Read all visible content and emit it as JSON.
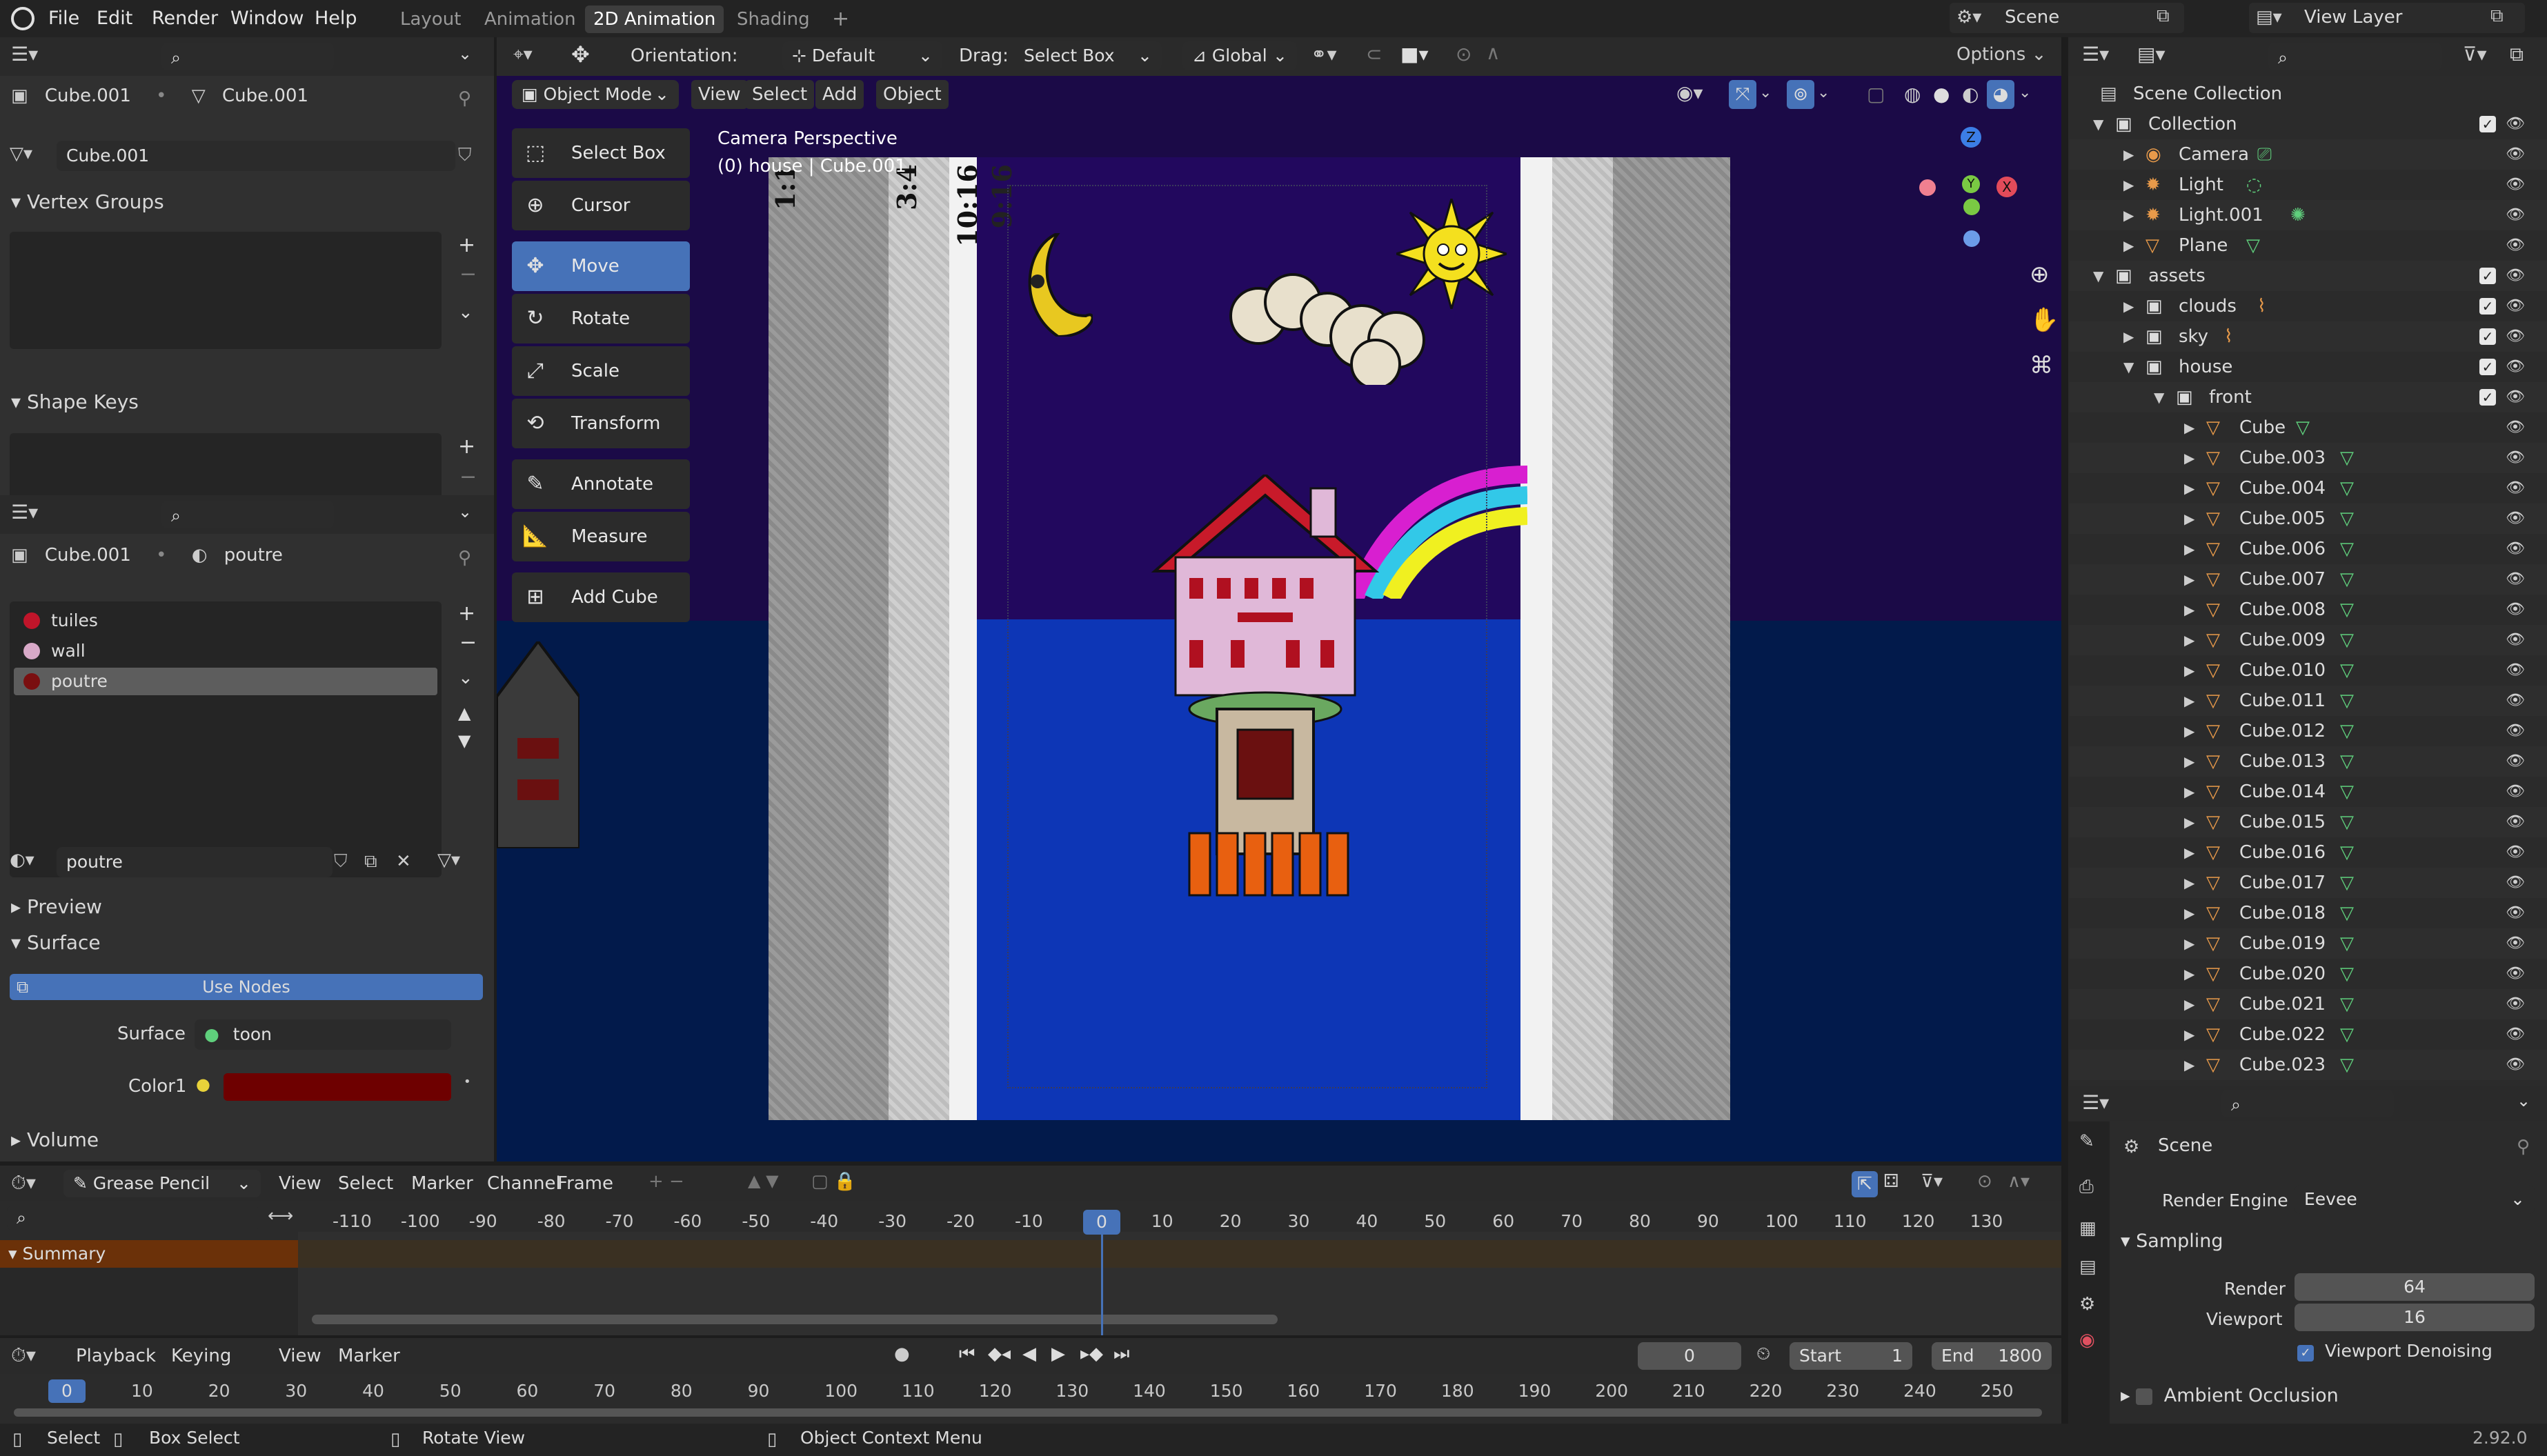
{
  "app": {
    "version": "2.92.0"
  },
  "menubar": {
    "items": [
      "File",
      "Edit",
      "Render",
      "Window",
      "Help"
    ],
    "tabs": [
      "Layout",
      "Animation",
      "2D Animation",
      "Shading"
    ],
    "active_tab": "2D Animation",
    "scene": "Scene",
    "view_layer": "View Layer"
  },
  "left": {
    "object_name": "Cube.001",
    "mesh_name": "Cube.001",
    "mesh_field": "Cube.001",
    "vertex_groups": "Vertex Groups",
    "shape_keys": "Shape Keys",
    "mat_object": "Cube.001",
    "mat_name": "poutre",
    "materials": [
      {
        "name": "tuiles",
        "color": "#c0152a"
      },
      {
        "name": "wall",
        "color": "#d8a9c8"
      },
      {
        "name": "poutre",
        "color": "#7a0f10"
      }
    ],
    "mat_field": "poutre",
    "preview": "Preview",
    "surface": "Surface",
    "use_nodes": "Use Nodes",
    "surface_label": "Surface",
    "surface_value": "toon",
    "color1_label": "Color1",
    "color1_value": "#6e0000",
    "volume": "Volume"
  },
  "viewport": {
    "header": {
      "orientation_label": "Orientation:",
      "orientation_value": "Default",
      "drag_label": "Drag:",
      "drag_value": "Select Box",
      "transform": "Global",
      "options": "Options"
    },
    "mode": "Object Mode",
    "menus": [
      "View",
      "Select",
      "Add",
      "Object"
    ],
    "tools": [
      "Select Box",
      "Cursor",
      "Move",
      "Rotate",
      "Scale",
      "Transform",
      "Annotate",
      "Measure",
      "Add Cube"
    ],
    "active_tool": "Move",
    "camera_label": "Camera Perspective",
    "camera_sub": "(0) house | Cube.001",
    "ratio_labels": [
      "1:1",
      "3:4",
      "10:16",
      "9:16"
    ],
    "gizmo": {
      "x": "X",
      "y": "Y",
      "z": "Z"
    }
  },
  "outliner": {
    "root": "Scene Collection",
    "rows": [
      {
        "label": "Collection",
        "indent": 1,
        "exp": "▼",
        "icon": "coll",
        "chk": true
      },
      {
        "label": "Camera",
        "indent": 2,
        "exp": "▶",
        "icon": "cam"
      },
      {
        "label": "Light",
        "indent": 2,
        "exp": "▶",
        "icon": "light"
      },
      {
        "label": "Light.001",
        "indent": 2,
        "exp": "▶",
        "icon": "light"
      },
      {
        "label": "Plane",
        "indent": 2,
        "exp": "▶",
        "icon": "mesh"
      },
      {
        "label": "assets",
        "indent": 1,
        "exp": "▼",
        "icon": "coll",
        "chk": true
      },
      {
        "label": "clouds",
        "indent": 2,
        "exp": "▶",
        "icon": "coll",
        "chk": true
      },
      {
        "label": "sky",
        "indent": 2,
        "exp": "▶",
        "icon": "coll",
        "chk": true
      },
      {
        "label": "house",
        "indent": 2,
        "exp": "▼",
        "icon": "coll",
        "chk": true
      },
      {
        "label": "front",
        "indent": 3,
        "exp": "▼",
        "icon": "coll",
        "chk": true
      },
      {
        "label": "Cube",
        "indent": 4,
        "exp": "▶",
        "icon": "mesh"
      },
      {
        "label": "Cube.003",
        "indent": 4,
        "exp": "▶",
        "icon": "mesh"
      },
      {
        "label": "Cube.004",
        "indent": 4,
        "exp": "▶",
        "icon": "mesh"
      },
      {
        "label": "Cube.005",
        "indent": 4,
        "exp": "▶",
        "icon": "mesh"
      },
      {
        "label": "Cube.006",
        "indent": 4,
        "exp": "▶",
        "icon": "mesh"
      },
      {
        "label": "Cube.007",
        "indent": 4,
        "exp": "▶",
        "icon": "mesh"
      },
      {
        "label": "Cube.008",
        "indent": 4,
        "exp": "▶",
        "icon": "mesh"
      },
      {
        "label": "Cube.009",
        "indent": 4,
        "exp": "▶",
        "icon": "mesh"
      },
      {
        "label": "Cube.010",
        "indent": 4,
        "exp": "▶",
        "icon": "mesh"
      },
      {
        "label": "Cube.011",
        "indent": 4,
        "exp": "▶",
        "icon": "mesh"
      },
      {
        "label": "Cube.012",
        "indent": 4,
        "exp": "▶",
        "icon": "mesh"
      },
      {
        "label": "Cube.013",
        "indent": 4,
        "exp": "▶",
        "icon": "mesh"
      },
      {
        "label": "Cube.014",
        "indent": 4,
        "exp": "▶",
        "icon": "mesh"
      },
      {
        "label": "Cube.015",
        "indent": 4,
        "exp": "▶",
        "icon": "mesh"
      },
      {
        "label": "Cube.016",
        "indent": 4,
        "exp": "▶",
        "icon": "mesh"
      },
      {
        "label": "Cube.017",
        "indent": 4,
        "exp": "▶",
        "icon": "mesh"
      },
      {
        "label": "Cube.018",
        "indent": 4,
        "exp": "▶",
        "icon": "mesh"
      },
      {
        "label": "Cube.019",
        "indent": 4,
        "exp": "▶",
        "icon": "mesh"
      },
      {
        "label": "Cube.020",
        "indent": 4,
        "exp": "▶",
        "icon": "mesh"
      },
      {
        "label": "Cube.021",
        "indent": 4,
        "exp": "▶",
        "icon": "mesh"
      },
      {
        "label": "Cube.022",
        "indent": 4,
        "exp": "▶",
        "icon": "mesh"
      },
      {
        "label": "Cube.023",
        "indent": 4,
        "exp": "▶",
        "icon": "mesh"
      }
    ]
  },
  "properties": {
    "context": "Scene",
    "render_engine_label": "Render Engine",
    "render_engine": "Eevee",
    "sampling": "Sampling",
    "render_label": "Render",
    "render_value": "64",
    "viewport_label": "Viewport",
    "viewport_value": "16",
    "denoise": "Viewport Denoising",
    "ambient": "Ambient Occlusion"
  },
  "dopesheet": {
    "mode": "Grease Pencil",
    "menus": [
      "View",
      "Select",
      "Marker",
      "Channel",
      "Frame"
    ],
    "summary": "Summary",
    "ticks": [
      "-110",
      "-100",
      "-90",
      "-80",
      "-70",
      "-60",
      "-50",
      "-40",
      "-30",
      "-20",
      "-10",
      "0",
      "10",
      "20",
      "30",
      "40",
      "50",
      "60",
      "70",
      "80",
      "90",
      "100",
      "110",
      "120",
      "130"
    ],
    "current": "0"
  },
  "timeline": {
    "menus": [
      "Playback",
      "Keying",
      "View",
      "Marker"
    ],
    "frame": "0",
    "start_label": "Start",
    "start": "1",
    "end_label": "End",
    "end": "1800",
    "ticks": [
      "0",
      "10",
      "20",
      "30",
      "40",
      "50",
      "60",
      "70",
      "80",
      "90",
      "100",
      "110",
      "120",
      "130",
      "140",
      "150",
      "160",
      "170",
      "180",
      "190",
      "200",
      "210",
      "220",
      "230",
      "240",
      "250"
    ]
  },
  "status": {
    "select": "Select",
    "box_select": "Box Select",
    "rotate": "Rotate View",
    "context": "Object Context Menu"
  }
}
